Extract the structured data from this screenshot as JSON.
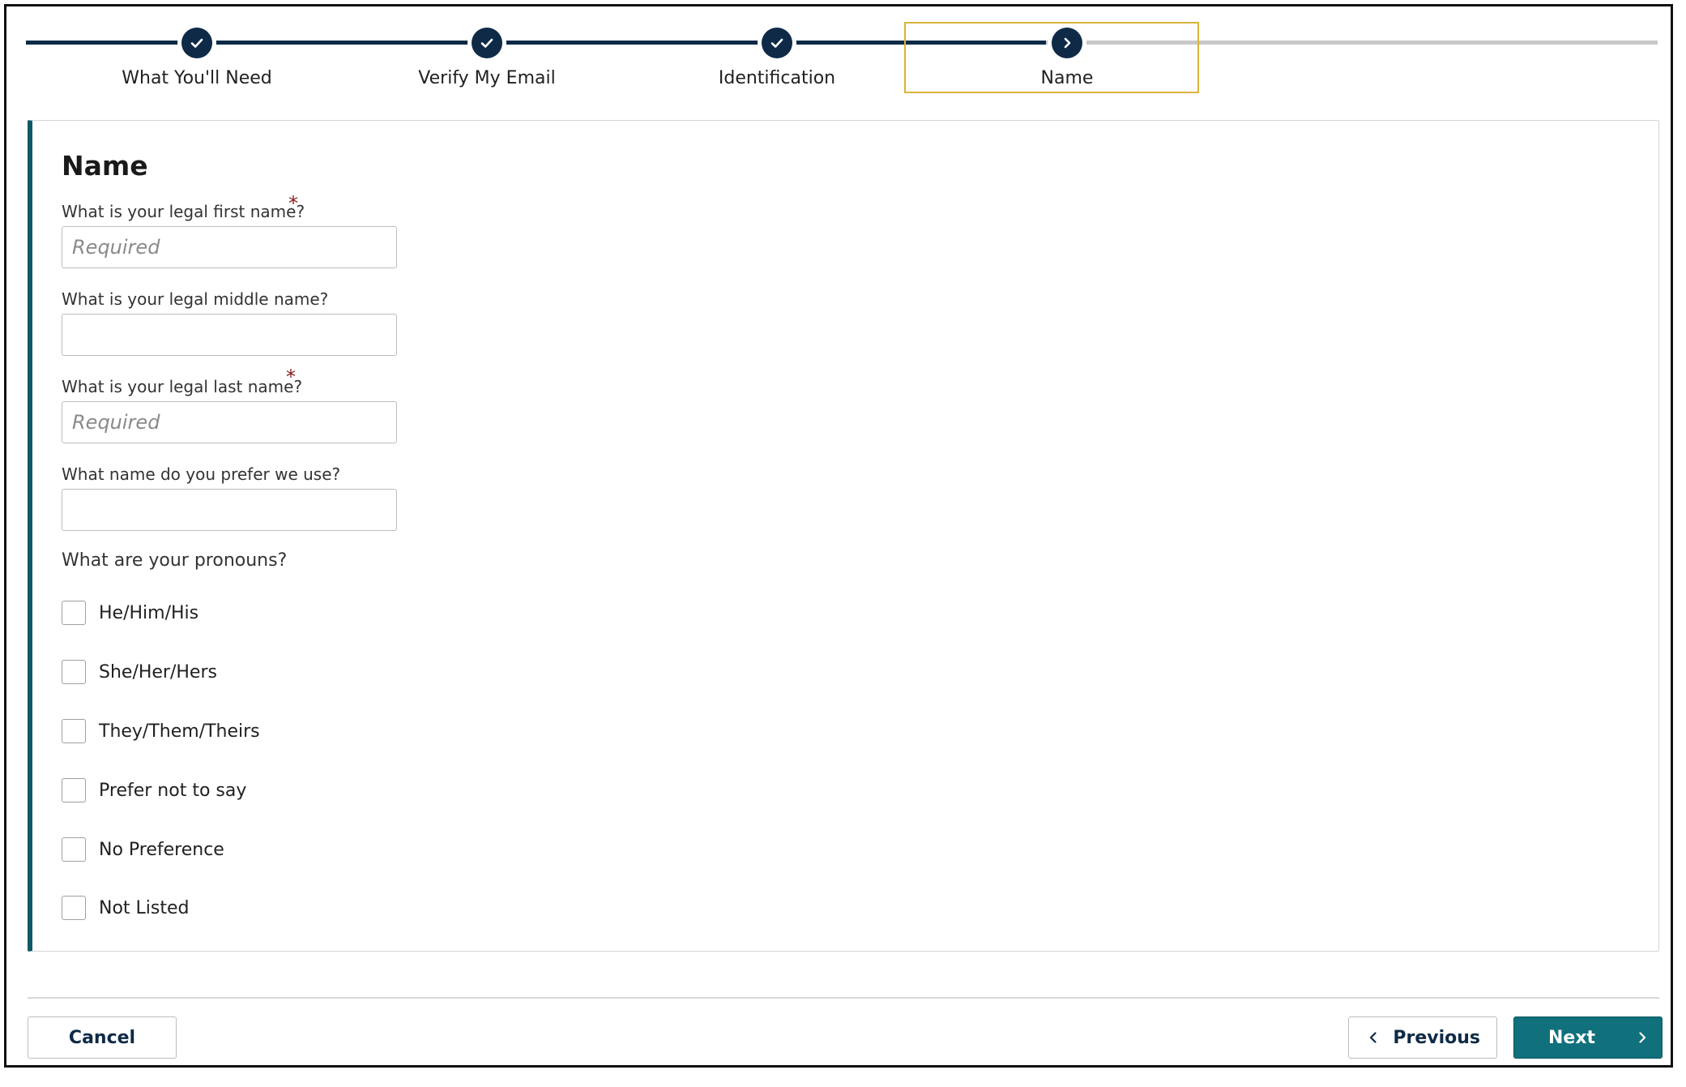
{
  "stepper": {
    "steps": [
      {
        "label": "What You'll Need",
        "status": "complete",
        "icon": "check-icon"
      },
      {
        "label": "Verify My Email",
        "status": "complete",
        "icon": "check-icon"
      },
      {
        "label": "Identification",
        "status": "complete",
        "icon": "check-icon"
      },
      {
        "label": "Name",
        "status": "current",
        "icon": "chevron-right-icon"
      }
    ]
  },
  "form": {
    "title": "Name",
    "first_name": {
      "label": "What is your legal first name?",
      "placeholder": "Required",
      "required_mark": "*"
    },
    "middle_name": {
      "label": "What is your legal middle name?",
      "placeholder": ""
    },
    "last_name": {
      "label": "What is your legal last name?",
      "placeholder": "Required",
      "required_mark": "*"
    },
    "preferred_name": {
      "label": "What name do you prefer we use?",
      "placeholder": ""
    },
    "pronouns": {
      "question": "What are your pronouns?",
      "options": [
        "He/Him/His",
        "She/Her/Hers",
        "They/Them/Theirs",
        "Prefer not to say",
        "No Preference",
        "Not Listed"
      ]
    }
  },
  "footer": {
    "cancel_label": "Cancel",
    "previous_label": "Previous",
    "next_label": "Next"
  },
  "colors": {
    "navy": "#0e2a47",
    "teal": "#10707c",
    "highlight": "#d8b53a",
    "required": "#8b1a1a"
  }
}
